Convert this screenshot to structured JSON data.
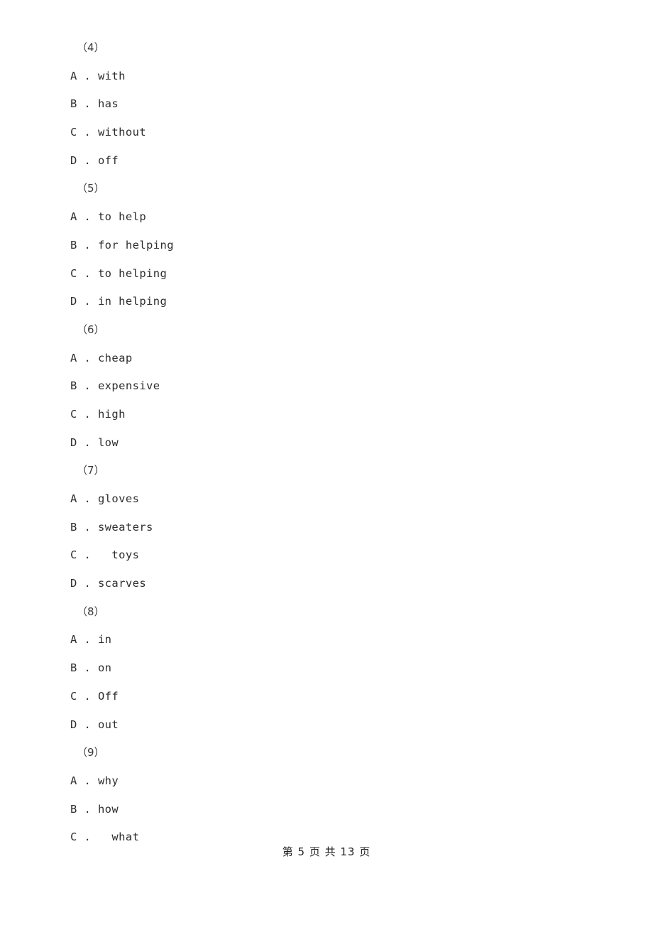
{
  "document": {
    "page_label": "第 5 页 共 13 页",
    "page_number": "5",
    "total_pages": "13",
    "text_color": "#2e2e30",
    "background_color": "#ffffff"
  },
  "lines": [
    {
      "kind": "group",
      "text": "（4）"
    },
    {
      "kind": "option",
      "letter": "A",
      "sep": " . ",
      "text": "with"
    },
    {
      "kind": "option",
      "letter": "B",
      "sep": " . ",
      "text": "has"
    },
    {
      "kind": "option",
      "letter": "C",
      "sep": " . ",
      "text": "without"
    },
    {
      "kind": "option",
      "letter": "D",
      "sep": " . ",
      "text": "off"
    },
    {
      "kind": "group",
      "text": "（5）"
    },
    {
      "kind": "option",
      "letter": "A",
      "sep": " . ",
      "text": "to help"
    },
    {
      "kind": "option",
      "letter": "B",
      "sep": " . ",
      "text": "for helping"
    },
    {
      "kind": "option",
      "letter": "C",
      "sep": " . ",
      "text": "to helping"
    },
    {
      "kind": "option",
      "letter": "D",
      "sep": " . ",
      "text": "in helping"
    },
    {
      "kind": "group",
      "text": "（6）"
    },
    {
      "kind": "option",
      "letter": "A",
      "sep": " . ",
      "text": "cheap"
    },
    {
      "kind": "option",
      "letter": "B",
      "sep": " . ",
      "text": "expensive"
    },
    {
      "kind": "option",
      "letter": "C",
      "sep": " . ",
      "text": "high"
    },
    {
      "kind": "option",
      "letter": "D",
      "sep": " . ",
      "text": "low"
    },
    {
      "kind": "group",
      "text": "（7）"
    },
    {
      "kind": "option",
      "letter": "A",
      "sep": " . ",
      "text": "gloves"
    },
    {
      "kind": "option",
      "letter": "B",
      "sep": " . ",
      "text": "sweaters"
    },
    {
      "kind": "option",
      "letter": "C",
      "sep": " .   ",
      "text": "toys"
    },
    {
      "kind": "option",
      "letter": "D",
      "sep": " . ",
      "text": "scarves"
    },
    {
      "kind": "group",
      "text": "（8）"
    },
    {
      "kind": "option",
      "letter": "A",
      "sep": " . ",
      "text": "in"
    },
    {
      "kind": "option",
      "letter": "B",
      "sep": " . ",
      "text": "on"
    },
    {
      "kind": "option",
      "letter": "C",
      "sep": " . ",
      "text": "Off"
    },
    {
      "kind": "option",
      "letter": "D",
      "sep": " . ",
      "text": "out"
    },
    {
      "kind": "group",
      "text": "（9）"
    },
    {
      "kind": "option",
      "letter": "A",
      "sep": " . ",
      "text": "why"
    },
    {
      "kind": "option",
      "letter": "B",
      "sep": " . ",
      "text": "how"
    },
    {
      "kind": "option",
      "letter": "C",
      "sep": " .   ",
      "text": "what"
    }
  ]
}
